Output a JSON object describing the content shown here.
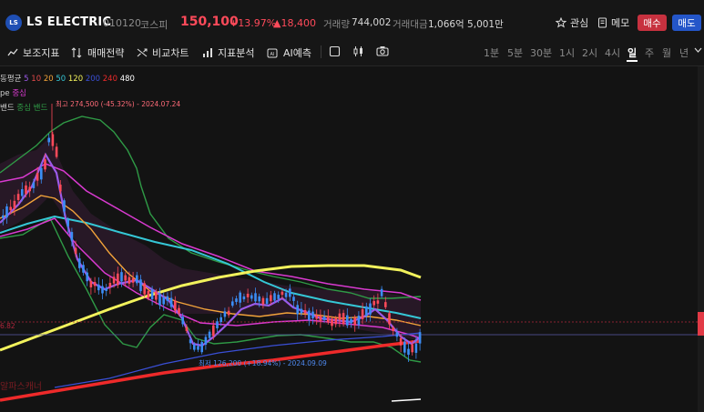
{
  "header": {
    "logo_text": "LS",
    "name": "LS ELECTRIC",
    "code": "010120",
    "market": "코스피",
    "price": "150,100",
    "change_pct": "+13.97%",
    "change_amt": "▲18,400",
    "volume_label": "거래량",
    "volume_value": "744,002",
    "amount_label": "거래대금",
    "amount_value": "1,066억 5,001만",
    "favorite_label": "관심",
    "memo_label": "메모",
    "buy_label": "매수",
    "sell_label": "매도"
  },
  "toolbar": {
    "indicators_label": "보조지표",
    "strategy_label": "매매전략",
    "compare_label": "비교차트",
    "analysis_label": "지표분석",
    "ai_label": "AI예측",
    "periods": [
      "1분",
      "5분",
      "30분",
      "1시",
      "2시",
      "4시",
      "일",
      "주",
      "월",
      "년"
    ],
    "active_period": "일"
  },
  "legend": {
    "ma_prefix": "동평균",
    "ma_values": [
      "5",
      "10",
      "20",
      "50",
      "120",
      "200",
      "240",
      "480"
    ],
    "ma_colors": [
      "#e24a4a",
      "#f2a33a",
      "#f5d442",
      "#35c7d6",
      "#f2f25c",
      "#3a4fd6",
      "#e83b3b",
      "#ffffff"
    ],
    "envelope_prefix": "pe",
    "envelope_label": "중심",
    "band_prefix": "밴드",
    "band_label": "중심 밴드"
  },
  "annotations": {
    "high": "최고 274,500 (-45.32%) - 2024.07.24",
    "low": "최저 126,200 (+18.94%) - 2024.09.09",
    "left_price": "6.82",
    "bottom_text": "알파스캐너"
  },
  "colors": {
    "up": "#ff4a5a",
    "down": "#3b8df5",
    "buy": "#c7313f",
    "sell": "#2456c9"
  }
}
